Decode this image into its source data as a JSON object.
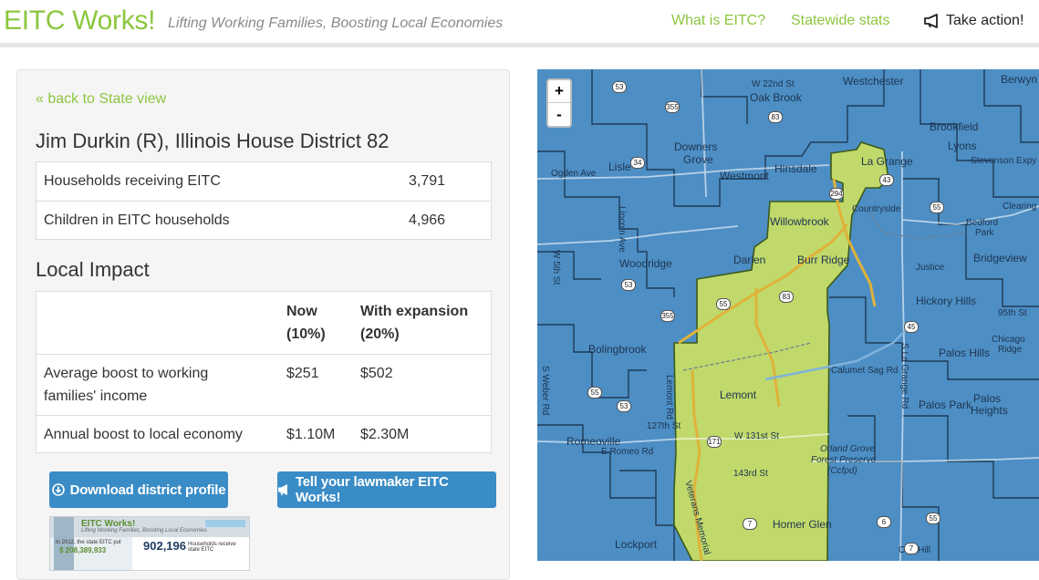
{
  "brand": "EITC Works!",
  "tagline": "Lifting Working Families, Boosting Local Economies",
  "nav": {
    "what": "What is EITC?",
    "stats": "Statewide stats",
    "action": "Take action!"
  },
  "panel": {
    "back_link": "« back to State view",
    "district_title": "Jim Durkin (R), Illinois House District 82",
    "stats": [
      {
        "label": "Households receiving EITC",
        "value": "3,791"
      },
      {
        "label": "Children in EITC households",
        "value": "4,966"
      }
    ],
    "impact_title": "Local Impact",
    "impact": {
      "col_now_line1": "Now",
      "col_now_line2": "(10%)",
      "col_exp_line1": "With expansion",
      "col_exp_line2": "(20%)",
      "rows": [
        {
          "label_line1": "Average boost to working",
          "label_line2": "families' income",
          "now": "$251",
          "expansion": "$502"
        },
        {
          "label_line1": "Annual boost to local economy",
          "label_line2": "",
          "now": "$1.10M",
          "expansion": "$2.30M"
        }
      ]
    },
    "download_button": "Download district profile",
    "tell_button": "Tell your lawmaker EITC Works!"
  },
  "thumbnail": {
    "title": "EITC Works!",
    "subtitle": "Lifting Working Families, Boosting Local Economies",
    "line1": "In 2012, the state EITC put",
    "money": "$ 208,389,933",
    "count": "902,196",
    "count_label": "Households receive state EITC"
  },
  "map": {
    "zoom_in": "+",
    "zoom_out": "-",
    "places": {
      "westchester": "Westchester",
      "berwyn": "Berwyn",
      "oak_brook": "Oak Brook",
      "w22nd": "W 22nd St",
      "downers_grove_1": "Downers",
      "downers_grove_2": "Grove",
      "westmont": "Westmont",
      "hinsdale": "Hinsdale",
      "la_grange": "La Grange",
      "lyons": "Lyons",
      "brookfield": "Brookfield",
      "ogden": "Ogden Ave",
      "lisle": "Lisle",
      "willowbrook": "Willowbrook",
      "countryside": "Countryside",
      "bedford_park_1": "Bedford",
      "bedford_park_2": "Park",
      "clearing": "Clearing",
      "stevenson": "Stevenson Expy",
      "woodridge": "Woodridge",
      "darien": "Darien",
      "burr_ridge": "Burr Ridge",
      "justice": "Justice",
      "bridgeview": "Bridgeview",
      "hickory_hills": "Hickory Hills",
      "w95th": "95th St",
      "bolingbrook": "Bolingbrook",
      "lemont_rd": "Lemont Rd",
      "calumet_sag": "Calumet Sag Rd",
      "palos_hills": "Palos Hills",
      "chicago_ridge_1": "Chicago",
      "chicago_ridge_2": "Ridge",
      "lemont": "Lemont",
      "palos_park": "Palos Park",
      "palos_heights_1": "Palos",
      "palos_heights_2": "Heights",
      "w127th": "127th St",
      "w131st": "W 131st St",
      "romeoville": "Romeoville",
      "e_romeo": "E Romeo Rd",
      "orland_1": "Orland Grove",
      "orland_2": "Forest Preserve",
      "orland_3": "(Ccfpd)",
      "w143rd": "143rd St",
      "homer_glen": "Homer Glen",
      "lockport": "Lockport",
      "oak_hill": "Oak Hill",
      "veterans": "Veterans Memorial",
      "s_la_grange": "S La Grange Rd",
      "lincoln": "Lincoln Ave",
      "weber": "S Weber Rd",
      "w5th": "W 5th St"
    },
    "shields": {
      "s53": "53",
      "s355": "355",
      "s83a": "83",
      "s34": "34",
      "s294": "294",
      "s55a": "55",
      "s83b": "83",
      "s55b": "55",
      "s53b": "53",
      "s83c": "83",
      "s355b": "355",
      "s45": "45",
      "s55c": "55",
      "s171": "171",
      "s7": "7",
      "s6": "6",
      "s7b": "7",
      "s53c": "53",
      "s43": "43",
      "s55d": "55"
    }
  }
}
